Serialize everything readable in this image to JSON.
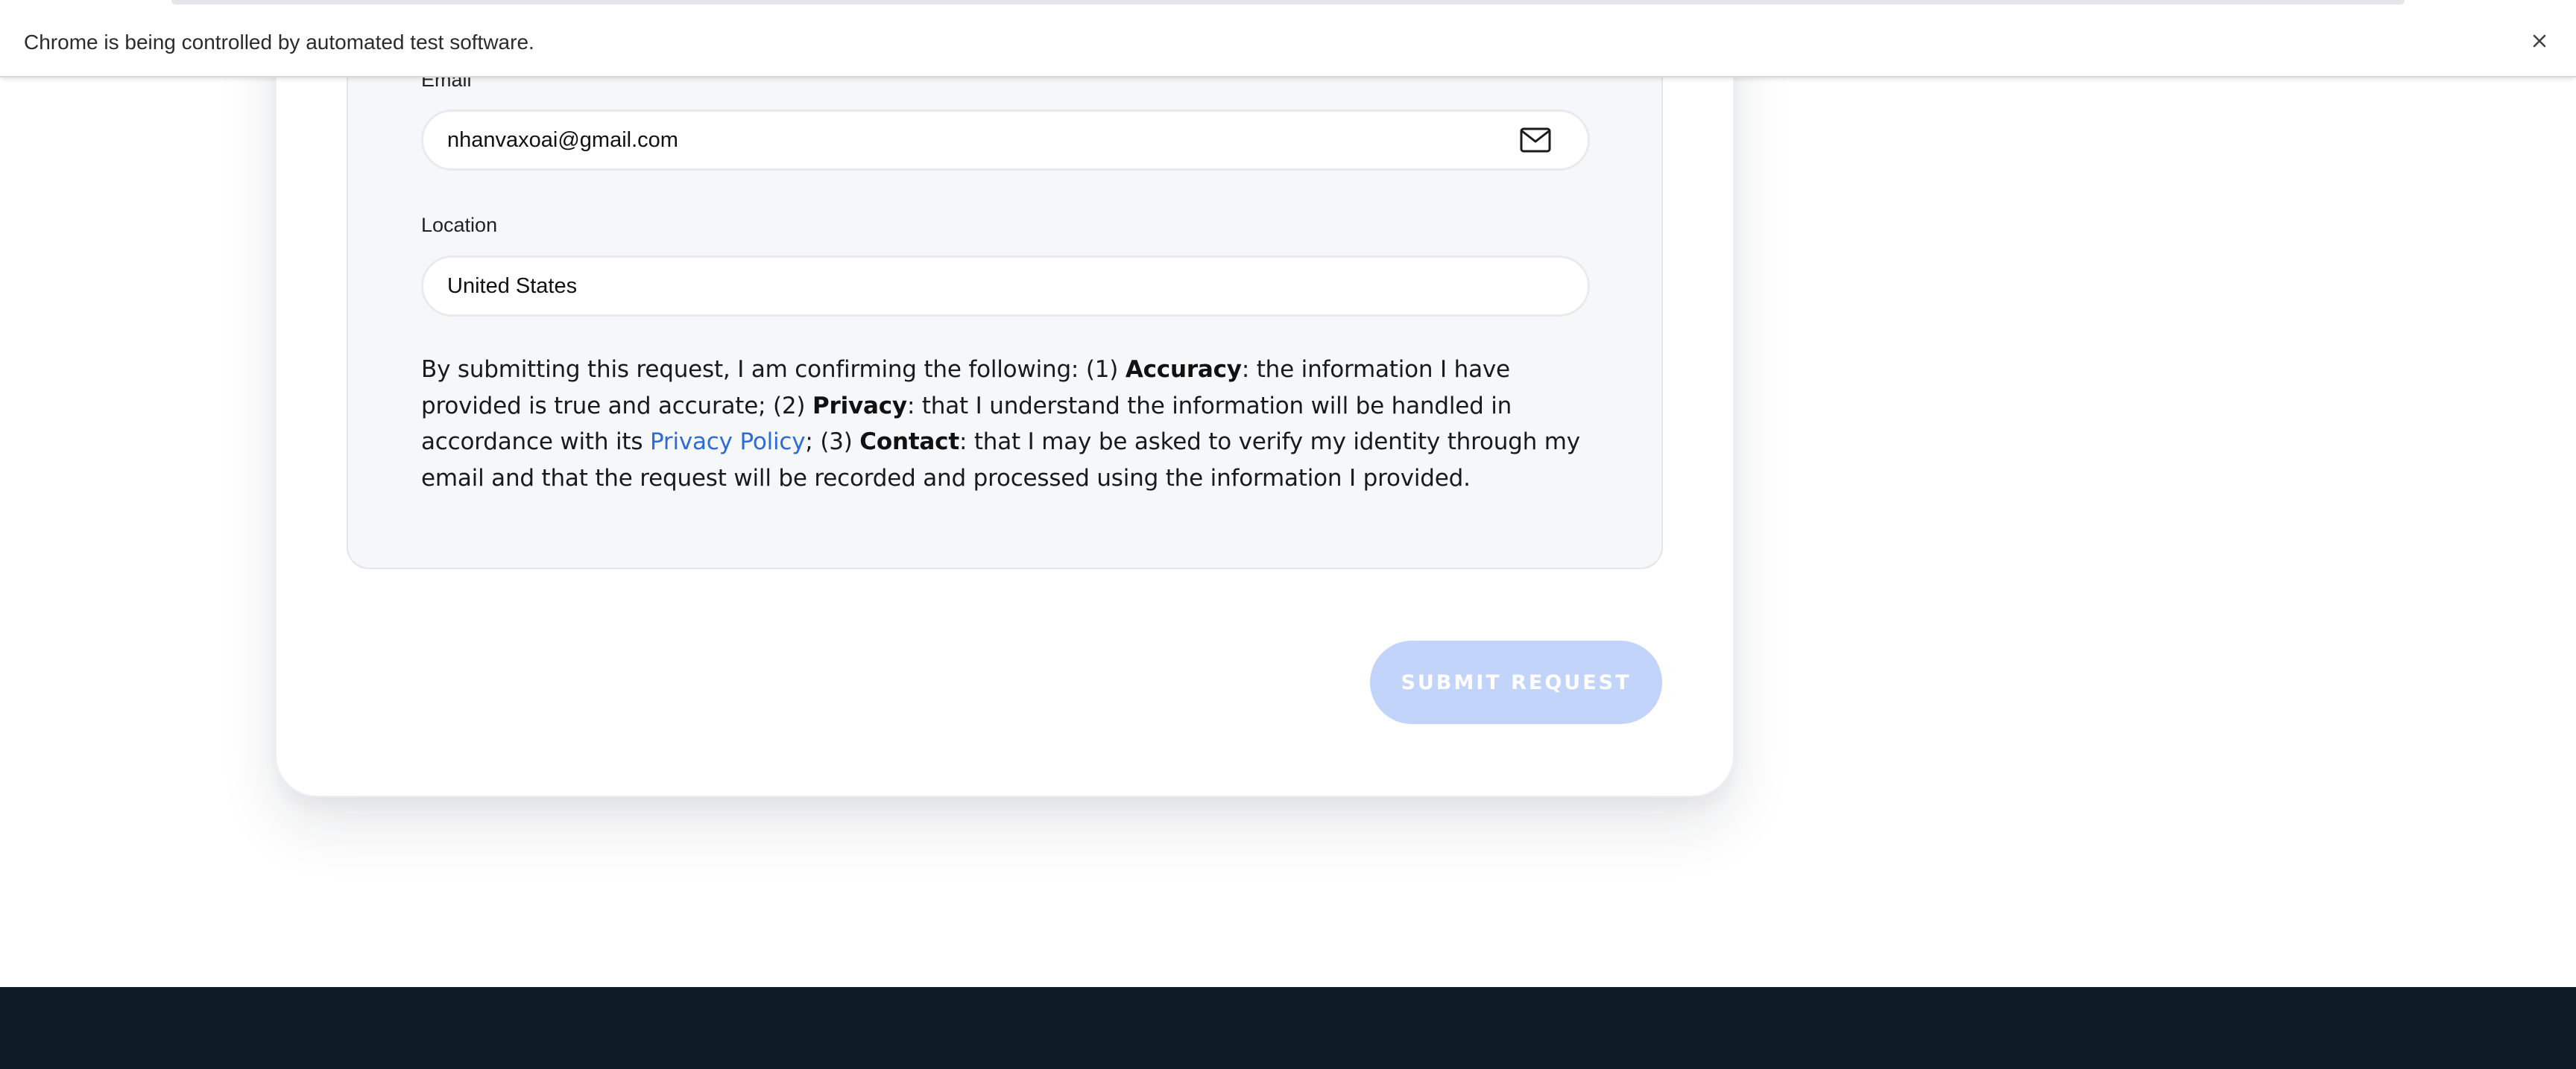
{
  "infobar": {
    "message": "Chrome is being controlled by automated test software.",
    "close_icon": "close-icon"
  },
  "form": {
    "email": {
      "label": "Email",
      "value": "nhanvaxoai@gmail.com",
      "icon": "mail-icon"
    },
    "location": {
      "label": "Location",
      "value": "United States"
    },
    "consent": {
      "intro": "By submitting this request, I am confirming the following: (1) ",
      "accuracy_label": "Accuracy",
      "accuracy_text": ": the information I have provided is true and accurate; (2) ",
      "privacy_label": "Privacy",
      "privacy_text": ": that I understand the information will be handled in accordance with its ",
      "privacy_link": "Privacy Policy",
      "after_link": "; (3) ",
      "contact_label": "Contact",
      "contact_text": ": that I may be asked to verify my identity through my email and that the request will be recorded and processed using the information I provided."
    },
    "submit_label": "SUBMIT REQUEST"
  },
  "colors": {
    "link": "#2f6ad9",
    "submit_disabled": "#c3d4fa",
    "footer": "#0f1c28",
    "panel": "#f6f7f9"
  }
}
